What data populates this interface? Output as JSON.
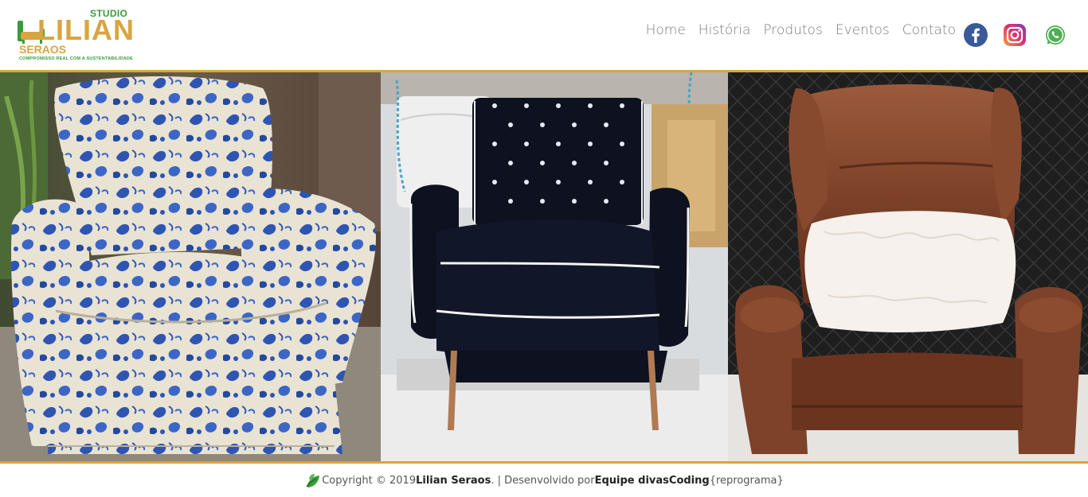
{
  "logo": {
    "studio": "STUDIO",
    "name": "LILIAN",
    "surname": "SERAOS",
    "tagline": "COMPROMISSO REAL COM A SUSTENTABILIDADE"
  },
  "nav": {
    "items": [
      {
        "label": "Home"
      },
      {
        "label": "História"
      },
      {
        "label": "Produtos"
      },
      {
        "label": "Eventos"
      },
      {
        "label": "Contato"
      }
    ]
  },
  "social": {
    "facebook": "facebook-icon",
    "instagram": "instagram-icon",
    "whatsapp": "whatsapp-icon"
  },
  "gallery": {
    "images": [
      "floral-armchair",
      "black-tufted-armchair",
      "brown-leather-wingchair"
    ]
  },
  "footer": {
    "copyright": "Copyright © 2019 ",
    "owner": "Lilian Seraos",
    "dev_prefix": ". | Desenvolvido por ",
    "team": "Equipe divasCoding",
    "suffix": " {reprograma}"
  },
  "colors": {
    "accent": "#d9a441",
    "green": "#3a9b3c",
    "nav_text": "#7a7a7a"
  }
}
